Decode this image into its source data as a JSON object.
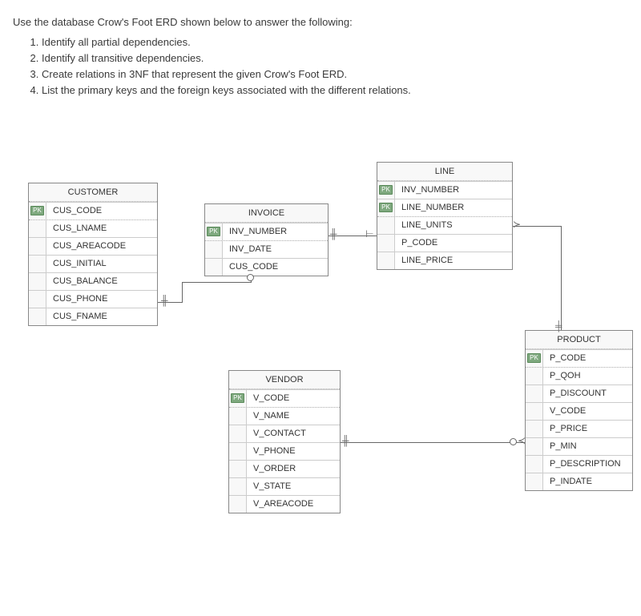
{
  "prompt": {
    "title": "Use the database Crow's Foot ERD shown below to answer the following:",
    "items": [
      "Identify all partial dependencies.",
      "Identify all transitive dependencies.",
      "Create relations in 3NF that represent the given Crow's Foot ERD.",
      "List the primary keys and the foreign keys associated with the different relations."
    ]
  },
  "pk_label": "PK",
  "entities": {
    "customer": {
      "title": "CUSTOMER",
      "attrs": [
        {
          "name": "CUS_CODE",
          "pk": true
        },
        {
          "name": "CUS_LNAME"
        },
        {
          "name": "CUS_AREACODE"
        },
        {
          "name": "CUS_INITIAL"
        },
        {
          "name": "CUS_BALANCE"
        },
        {
          "name": "CUS_PHONE"
        },
        {
          "name": "CUS_FNAME"
        }
      ]
    },
    "invoice": {
      "title": "INVOICE",
      "attrs": [
        {
          "name": "INV_NUMBER",
          "pk": true
        },
        {
          "name": "INV_DATE"
        },
        {
          "name": "CUS_CODE"
        }
      ]
    },
    "line": {
      "title": "LINE",
      "attrs": [
        {
          "name": "INV_NUMBER",
          "pk": true
        },
        {
          "name": "LINE_NUMBER",
          "pk": true
        },
        {
          "name": "LINE_UNITS"
        },
        {
          "name": "P_CODE"
        },
        {
          "name": "LINE_PRICE"
        }
      ]
    },
    "product": {
      "title": "PRODUCT",
      "attrs": [
        {
          "name": "P_CODE",
          "pk": true
        },
        {
          "name": "P_QOH"
        },
        {
          "name": "P_DISCOUNT"
        },
        {
          "name": "V_CODE"
        },
        {
          "name": "P_PRICE"
        },
        {
          "name": "P_MIN"
        },
        {
          "name": "P_DESCRIPTION"
        },
        {
          "name": "P_INDATE"
        }
      ]
    },
    "vendor": {
      "title": "VENDOR",
      "attrs": [
        {
          "name": "V_CODE",
          "pk": true
        },
        {
          "name": "V_NAME"
        },
        {
          "name": "V_CONTACT"
        },
        {
          "name": "V_PHONE"
        },
        {
          "name": "V_ORDER"
        },
        {
          "name": "V_STATE"
        },
        {
          "name": "V_AREACODE"
        }
      ]
    }
  }
}
